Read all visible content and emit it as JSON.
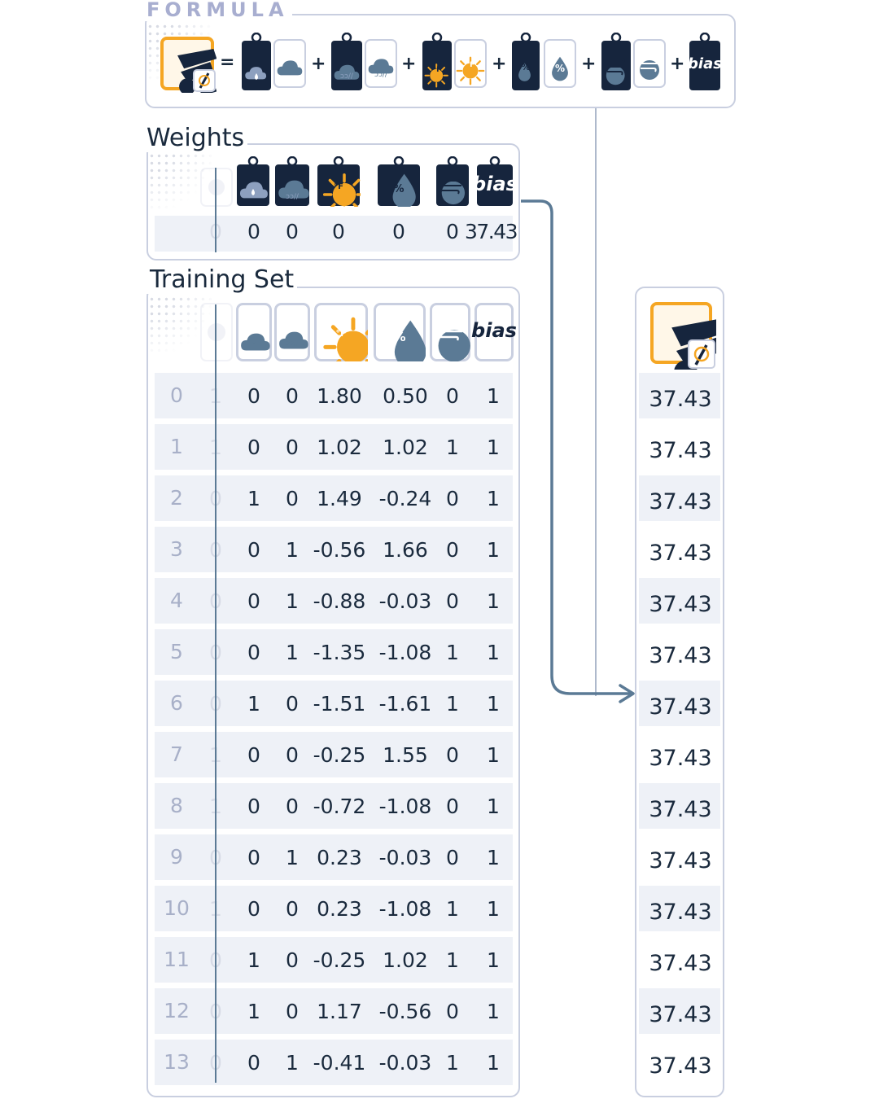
{
  "formula": {
    "title": "FORMULA",
    "equals": "=",
    "plus": "+",
    "bias_label": "bias"
  },
  "weights": {
    "title": "Weights",
    "bias_label": "bias",
    "ghost_value": "0",
    "values": [
      "0",
      "0",
      "0",
      "0",
      "0",
      "37.43"
    ]
  },
  "training": {
    "title": "Training Set",
    "bias_label": "bias",
    "rows": [
      {
        "idx": "0",
        "ghost": "1",
        "cells": [
          "0",
          "0",
          "1.80",
          "0.50",
          "0",
          "1"
        ]
      },
      {
        "idx": "1",
        "ghost": "1",
        "cells": [
          "0",
          "0",
          "1.02",
          "1.02",
          "1",
          "1"
        ]
      },
      {
        "idx": "2",
        "ghost": "0",
        "cells": [
          "1",
          "0",
          "1.49",
          "-0.24",
          "0",
          "1"
        ]
      },
      {
        "idx": "3",
        "ghost": "0",
        "cells": [
          "0",
          "1",
          "-0.56",
          "1.66",
          "0",
          "1"
        ]
      },
      {
        "idx": "4",
        "ghost": "0",
        "cells": [
          "0",
          "1",
          "-0.88",
          "-0.03",
          "0",
          "1"
        ]
      },
      {
        "idx": "5",
        "ghost": "0",
        "cells": [
          "0",
          "1",
          "-1.35",
          "-1.08",
          "1",
          "1"
        ]
      },
      {
        "idx": "6",
        "ghost": "0",
        "cells": [
          "1",
          "0",
          "-1.51",
          "-1.61",
          "1",
          "1"
        ]
      },
      {
        "idx": "7",
        "ghost": "1",
        "cells": [
          "0",
          "0",
          "-0.25",
          "1.55",
          "0",
          "1"
        ]
      },
      {
        "idx": "8",
        "ghost": "1",
        "cells": [
          "0",
          "0",
          "-0.72",
          "-1.08",
          "0",
          "1"
        ]
      },
      {
        "idx": "9",
        "ghost": "0",
        "cells": [
          "0",
          "1",
          "0.23",
          "-0.03",
          "0",
          "1"
        ]
      },
      {
        "idx": "10",
        "ghost": "1",
        "cells": [
          "0",
          "0",
          "0.23",
          "-1.08",
          "1",
          "1"
        ]
      },
      {
        "idx": "11",
        "ghost": "0",
        "cells": [
          "1",
          "0",
          "-0.25",
          "1.02",
          "1",
          "1"
        ]
      },
      {
        "idx": "12",
        "ghost": "0",
        "cells": [
          "1",
          "0",
          "1.17",
          "-0.56",
          "0",
          "1"
        ]
      },
      {
        "idx": "13",
        "ghost": "0",
        "cells": [
          "0",
          "1",
          "-0.41",
          "-0.03",
          "1",
          "1"
        ]
      }
    ]
  },
  "predictions": [
    "37.43",
    "37.43",
    "37.43",
    "37.43",
    "37.43",
    "37.43",
    "37.43",
    "37.43",
    "37.43",
    "37.43",
    "37.43",
    "37.43",
    "37.43",
    "37.43"
  ],
  "icons": [
    "ice-cream-sales-icon",
    "rain-icon",
    "snow-icon",
    "temperature-icon",
    "humidity-icon",
    "wind-icon",
    "bias-icon"
  ],
  "colors": {
    "navy": "#16253d",
    "tile": "#ffffff",
    "tile_border": "#c9cfe0",
    "accent": "#f5a623",
    "slate": "#5b7a95",
    "stripe": "#eef1f7"
  }
}
